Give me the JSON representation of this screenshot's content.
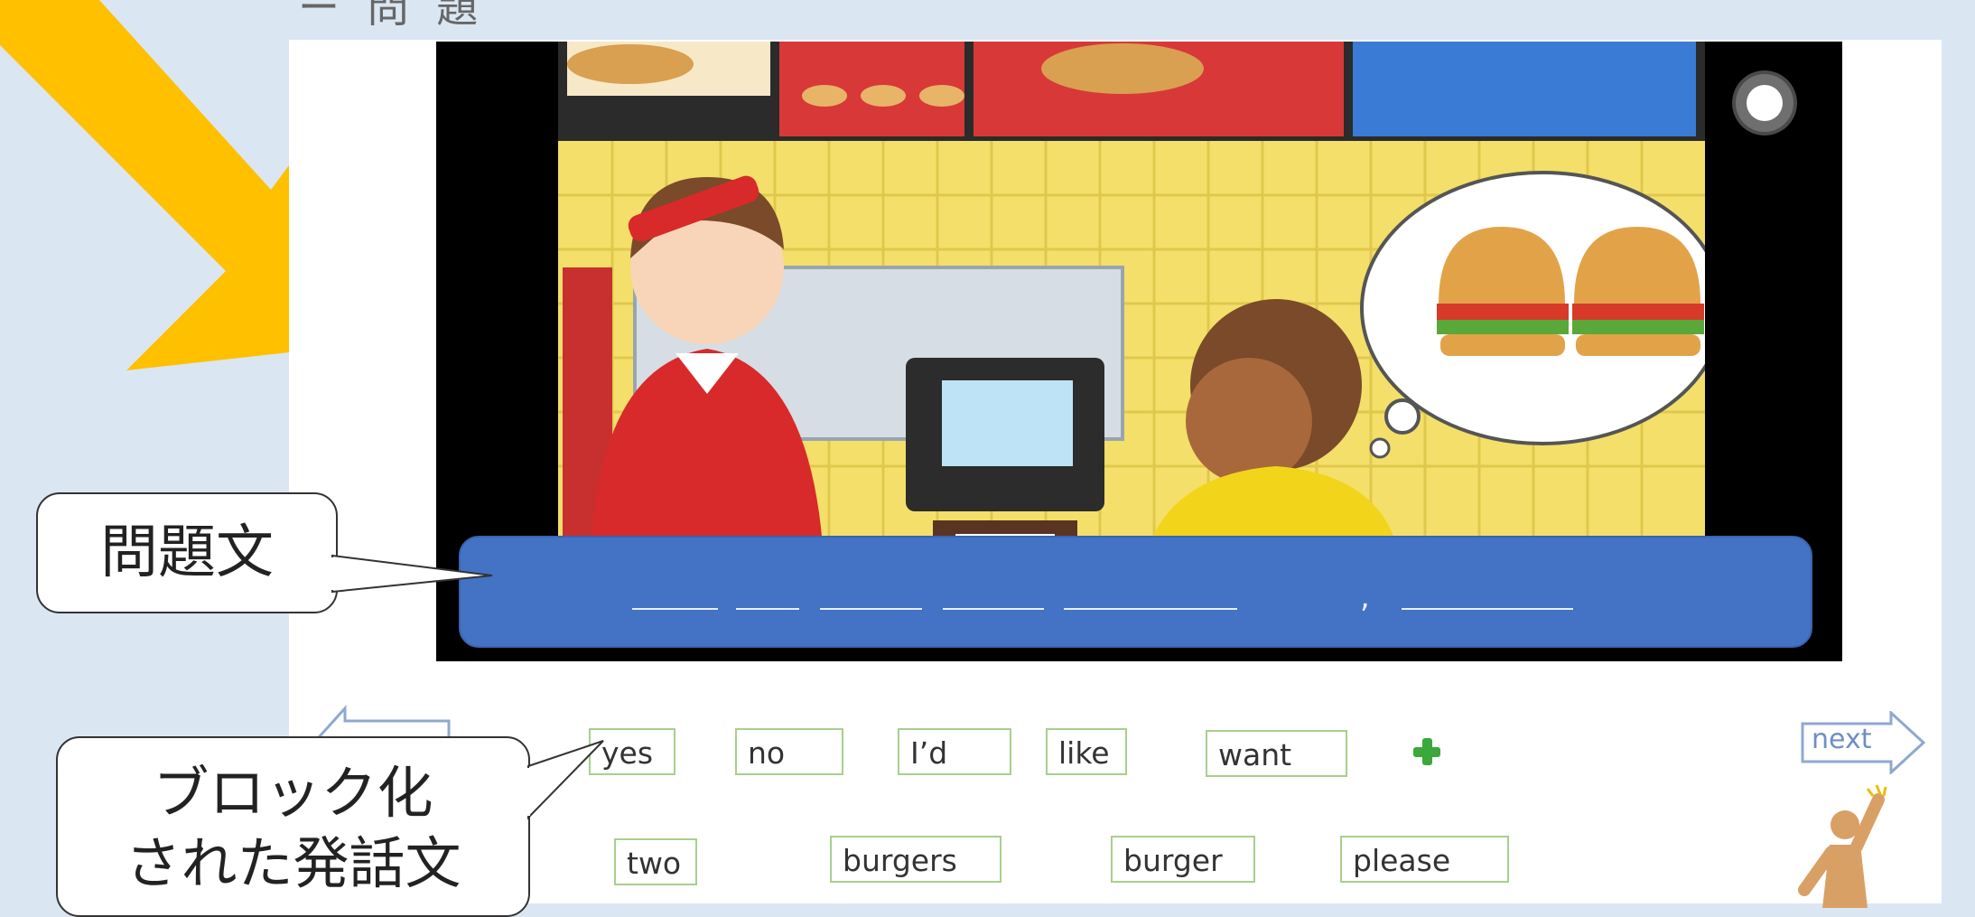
{
  "header": {
    "title_fragment": "ー 問 題"
  },
  "scene": {
    "description_icons": [
      "burger-icon",
      "customer-icon",
      "clerk-icon",
      "register-icon",
      "thought-bubble-icon"
    ],
    "record_button_icon": "record-icon"
  },
  "question": {
    "comma": ","
  },
  "word_blocks": {
    "row1": [
      "yes",
      "no",
      "I’d",
      "like",
      "want"
    ],
    "row2": [
      "two",
      "burgers",
      "burger",
      "please"
    ]
  },
  "navigation": {
    "next_label": "next"
  },
  "callouts": {
    "question_label": "問題文",
    "blocks_label_line1": "ブロック化",
    "blocks_label_line2": "された発話文"
  },
  "colors": {
    "question_bar": "#4472c4",
    "block_border": "#a8cf8e",
    "add_button": "#3aa83a",
    "pointer_arrow": "#ffc000",
    "background": "#dbe6f3"
  }
}
